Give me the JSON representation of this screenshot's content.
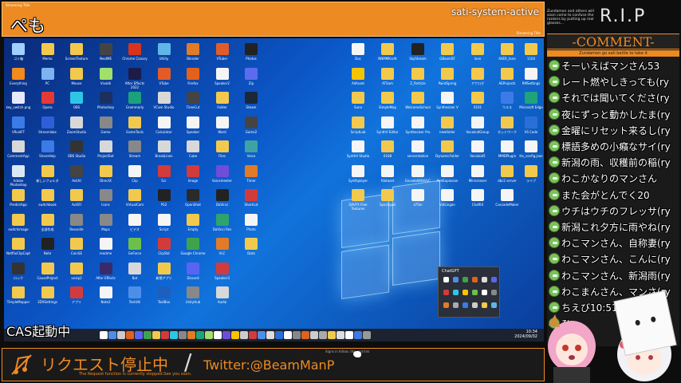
{
  "header": {
    "title": "ぺも",
    "app_name": "sati-system-active",
    "small_left": "Streaming Title",
    "small_right": "Streaming Title"
  },
  "rip": {
    "text": "R.I.P",
    "notice": "Zundamon and others will soon come to confuse the rankers by putting up real glasses..."
  },
  "comments": {
    "title": "-COMMENT-",
    "subtitle": "Zundamon go sati battle to take it",
    "items": [
      "そーいえばマンさん53",
      "レート燃やしきっても(ry",
      "それでは聞いてくださ(ry",
      "夜にずっと動かしたま(ry",
      "金曜にリセット来るし(ry",
      "標語多めの小癪なサイ(ry",
      "新潟の雨、収穫前の稲(ry",
      "わこかなりのマンさん",
      "また会がとんでく20",
      "ウチはウチのフレッサ(ry",
      "新潟これ夕方に雨やね(ry",
      "わこマンさん、自称妻(ry",
      "わこマンさん、こんに(ry",
      "わこマンさん、新潟雨(ry",
      "わこまんさん、マンさ(ry",
      "ちえび10:5112",
      "ひ"
    ]
  },
  "desktop": {
    "icons": [
      {
        "label": "ゴミ箱",
        "color": "#9fd0ff"
      },
      {
        "label": "Everything",
        "color": "#f28a1c"
      },
      {
        "label": "key_switch.png",
        "color": "#e8e8ff"
      },
      {
        "label": "VRoidFT",
        "color": "#3b7be8"
      },
      {
        "label": "CommentApp",
        "color": "#d8d8d8"
      },
      {
        "label": "Adobe Photoshop 2021",
        "color": "#dbe7f5"
      },
      {
        "label": "PredictApp",
        "color": "#f2c94c"
      },
      {
        "label": "switchimage",
        "color": "#f2c94c"
      },
      {
        "label": "NetflixClipCapt",
        "color": "#f2c94c"
      },
      {
        "label": "ロック",
        "color": "#333"
      },
      {
        "label": "TimpleMapper",
        "color": "#f2c94c"
      },
      {
        "label": "Memo",
        "color": "#f2c94c"
      },
      {
        "label": "PC",
        "color": "#7db3f0"
      },
      {
        "label": "Opera",
        "color": "#e53935"
      },
      {
        "label": "Streamlabs",
        "color": "#2f5fd8"
      },
      {
        "label": "ShareHelp",
        "color": "#3b7be8"
      },
      {
        "label": "新しいフォルダ",
        "color": "#f2c94c"
      },
      {
        "label": "switchbook",
        "color": "#f2c94c"
      },
      {
        "label": "全部作成",
        "color": "#f2c94c"
      },
      {
        "label": "Note",
        "color": "#222"
      },
      {
        "label": "CauseProject",
        "color": "#f2c94c"
      },
      {
        "label": "3DXSettings",
        "color": "#f2c94c"
      },
      {
        "label": "ScreenTexture",
        "color": "#f2c94c"
      },
      {
        "label": "Mouse",
        "color": "#f2c94c"
      },
      {
        "label": "OBS",
        "color": "#2ec6e6"
      },
      {
        "label": "ZoomStudio",
        "color": "#d8d8d8"
      },
      {
        "label": "OBS Studio",
        "color": "#333"
      },
      {
        "label": "AviUtl",
        "color": "#444"
      },
      {
        "label": "AviSFI",
        "color": "#f2c94c"
      },
      {
        "label": "Resonite",
        "color": "#888"
      },
      {
        "label": "CoinSE",
        "color": "#f2c94c"
      },
      {
        "label": "unzip2",
        "color": "#f2c94c"
      },
      {
        "label": "アプリ",
        "color": "#d23b3b"
      },
      {
        "label": "NeoIME",
        "color": "#444"
      },
      {
        "label": "Vivaldi",
        "color": "#a1e06c"
      },
      {
        "label": "Photoshop",
        "color": "#1d2f5f"
      },
      {
        "label": "Game",
        "color": "#888"
      },
      {
        "label": "ProjectSet",
        "color": "#d8d8d8"
      },
      {
        "label": "DIrectX",
        "color": "#f2c94c"
      },
      {
        "label": "Icons",
        "color": "#888"
      },
      {
        "label": "Maps",
        "color": "#888"
      },
      {
        "label": "readme",
        "color": "#f5f5f5"
      },
      {
        "label": "After Effects",
        "color": "#3a2a6a"
      },
      {
        "label": "Note2",
        "color": "#f5f5f5"
      },
      {
        "label": "Chrome Canary",
        "color": "#d6341f"
      },
      {
        "label": "After Effects 2022",
        "color": "#1c1c4a"
      },
      {
        "label": "Grammarly",
        "color": "#1aa37a"
      },
      {
        "label": "GameTools",
        "color": "#f2c94c"
      },
      {
        "label": "Stream",
        "color": "#888"
      },
      {
        "label": "Clip",
        "color": "#f5f5f5"
      },
      {
        "label": "VirtualCam",
        "color": "#f2c94c"
      },
      {
        "label": "ビデオ",
        "color": "#f5f5f5"
      },
      {
        "label": "GeForce",
        "color": "#6cc04a"
      },
      {
        "label": "Bot",
        "color": "#d8d8d8"
      },
      {
        "label": "TestUtil",
        "color": "#4d8ee8"
      },
      {
        "label": "Utility",
        "color": "#5fb6e8"
      },
      {
        "label": "VTube",
        "color": "#e25c2a"
      },
      {
        "label": "VCam Studio",
        "color": "#d8d8d8"
      },
      {
        "label": "Calculator",
        "color": "#f5f5f5"
      },
      {
        "label": "BreakLines",
        "color": "#d8d8d8"
      },
      {
        "label": "Scr",
        "color": "#d23b3b"
      },
      {
        "label": "PS2",
        "color": "#222"
      },
      {
        "label": "Script",
        "color": "#f5f5f5"
      },
      {
        "label": "ClipStd",
        "color": "#d23b3b"
      },
      {
        "label": "新規アプリ",
        "color": "#f2c94c"
      },
      {
        "label": "ToolBox",
        "color": "#1c5fbf"
      },
      {
        "label": "Blender",
        "color": "#e27b26"
      },
      {
        "label": "Firefox",
        "color": "#e2621c"
      },
      {
        "label": "TimeCut",
        "color": "#444"
      },
      {
        "label": "Speaker",
        "color": "#f5f5f5"
      },
      {
        "label": "Cube",
        "color": "#d8d8d8"
      },
      {
        "label": "Image",
        "color": "#d23b3b"
      },
      {
        "label": "OpenShot",
        "color": "#2a2a2a"
      },
      {
        "label": "Empty",
        "color": "#f2c94c"
      },
      {
        "label": "Google Chrome",
        "color": "#3fa34d"
      },
      {
        "label": "Discord",
        "color": "#5865f2"
      },
      {
        "label": "UnityHub",
        "color": "#888"
      },
      {
        "label": "VTuber",
        "color": "#e25c2a"
      },
      {
        "label": "Speaker2",
        "color": "#f5f5f5"
      },
      {
        "label": "Folder",
        "color": "#f2c94c"
      },
      {
        "label": "Word",
        "color": "#f5f5f5"
      },
      {
        "label": "Files",
        "color": "#f2c94c"
      },
      {
        "label": "Voicemeeter",
        "color": "#6f4dd8"
      },
      {
        "label": "DaVinci",
        "color": "#222"
      },
      {
        "label": "DaVinci Res",
        "color": "#2fa36e"
      },
      {
        "label": "VLC",
        "color": "#e27b26"
      },
      {
        "label": "Speaker3",
        "color": "#d23b3b"
      },
      {
        "label": "Audio",
        "color": "#d8d8d8"
      },
      {
        "label": "Photos",
        "color": "#222"
      },
      {
        "label": "Zip",
        "color": "#5b6cf0"
      },
      {
        "label": "Steam",
        "color": "#1b2838"
      },
      {
        "label": "Game2",
        "color": "#444"
      },
      {
        "label": "Voice",
        "color": "#3fa3a3"
      },
      {
        "label": "Timer",
        "color": "#e27b26"
      },
      {
        "label": "Shortcut",
        "color": "#d23b3b"
      },
      {
        "label": "Photo",
        "color": "#f5f5f5"
      },
      {
        "label": "Data",
        "color": "#f2c94c"
      },
      {
        "label": "Doc",
        "color": "#f5f5f5"
      },
      {
        "label": "NNMMKrsAt",
        "color": "#f2c94c"
      },
      {
        "label": "SkyStream",
        "color": "#222"
      },
      {
        "label": "GBeamSF",
        "color": "#f2c94c"
      },
      {
        "label": "love",
        "color": "#f2c94c"
      },
      {
        "label": "AVER_tone",
        "color": "#f2c94c"
      },
      {
        "label": "1104",
        "color": "#f2c94c"
      },
      {
        "label": "AllAsset",
        "color": "#f5c400"
      },
      {
        "label": "ATSam",
        "color": "#f2c94c"
      },
      {
        "label": "Z_Particle",
        "color": "#f2c94c"
      },
      {
        "label": "PaintSpring",
        "color": "#f2c94c"
      },
      {
        "label": "アナログ",
        "color": "#f2c94c"
      },
      {
        "label": "AEProjects",
        "color": "#f2c94c"
      },
      {
        "label": "RMSettings",
        "color": "#f5f5f5"
      },
      {
        "label": "Suno",
        "color": "#f2c94c"
      },
      {
        "label": "SimpleMap",
        "color": "#f2c94c"
      },
      {
        "label": "WelcomeSchool",
        "color": "#f2c94c"
      },
      {
        "label": "Synthesizer V",
        "color": "#f5f5f5"
      },
      {
        "label": "0101",
        "color": "#f2c94c"
      },
      {
        "label": "ウルス",
        "color": "#3b7be8"
      },
      {
        "label": "Microsoft Edge",
        "color": "#1fa37a"
      },
      {
        "label": "ScriptLab",
        "color": "#f2c94c"
      },
      {
        "label": "SynthV Editor",
        "color": "#f5f5f5"
      },
      {
        "label": "Synthesizer Pro",
        "color": "#f5f5f5"
      },
      {
        "label": "newfolder",
        "color": "#f2c94c"
      },
      {
        "label": "VocaloidGroup",
        "color": "#f5f5f5"
      },
      {
        "label": "ネットワーク",
        "color": "#f2c94c"
      },
      {
        "label": "VS Code",
        "color": "#2a6fd8"
      },
      {
        "label": "SynthV Studio",
        "color": "#f5f5f5"
      },
      {
        "label": "0108",
        "color": "#f2c94c"
      },
      {
        "label": "serverstation",
        "color": "#f5f5f5"
      },
      {
        "label": "DynamicFolder",
        "color": "#f2c94c"
      },
      {
        "label": "Vocaloid5",
        "color": "#f5f5f5"
      },
      {
        "label": "MMDPlugin",
        "color": "#f5f5f5"
      },
      {
        "label": "ttx_config.json",
        "color": "#f5f5f5"
      },
      {
        "label": "Synthplayer",
        "color": "#f5f5f5"
      },
      {
        "label": "fdataset",
        "color": "#f5f5f5"
      },
      {
        "label": "EncodeWithVLC",
        "color": "#f5f5f5"
      },
      {
        "label": "AimExplosion",
        "color": "#f5f5f5"
      },
      {
        "label": "Mirrorsever",
        "color": "#f5f5f5"
      },
      {
        "label": "dbc2 server",
        "color": "#f2c94c"
      },
      {
        "label": "ライブ",
        "color": "#f2c94c"
      },
      {
        "label": "DAVFX Free Textures",
        "color": "#f2c94c"
      },
      {
        "label": "SyncInput",
        "color": "#f2c94c"
      },
      {
        "label": "aTSin",
        "color": "#f5f5f5"
      },
      {
        "label": "VidLingon",
        "color": "#f5f5f5"
      },
      {
        "label": "ChaRIX",
        "color": "#f5f5f5"
      },
      {
        "label": "CascadeMaker",
        "color": "#f5f5f5"
      }
    ]
  },
  "taskbar": {
    "time": "10:34",
    "date": "2024/09/02"
  },
  "chat_popup": {
    "title": "ChatGPT"
  },
  "cas_label": "CAS起動中",
  "bottom": {
    "request_text": "リクエスト停止中",
    "request_sub": "The Request function is currently stopped.See you soon.",
    "twitter": "Twitter:@BeamManP",
    "tiny": "Signs in follow, like and link"
  }
}
